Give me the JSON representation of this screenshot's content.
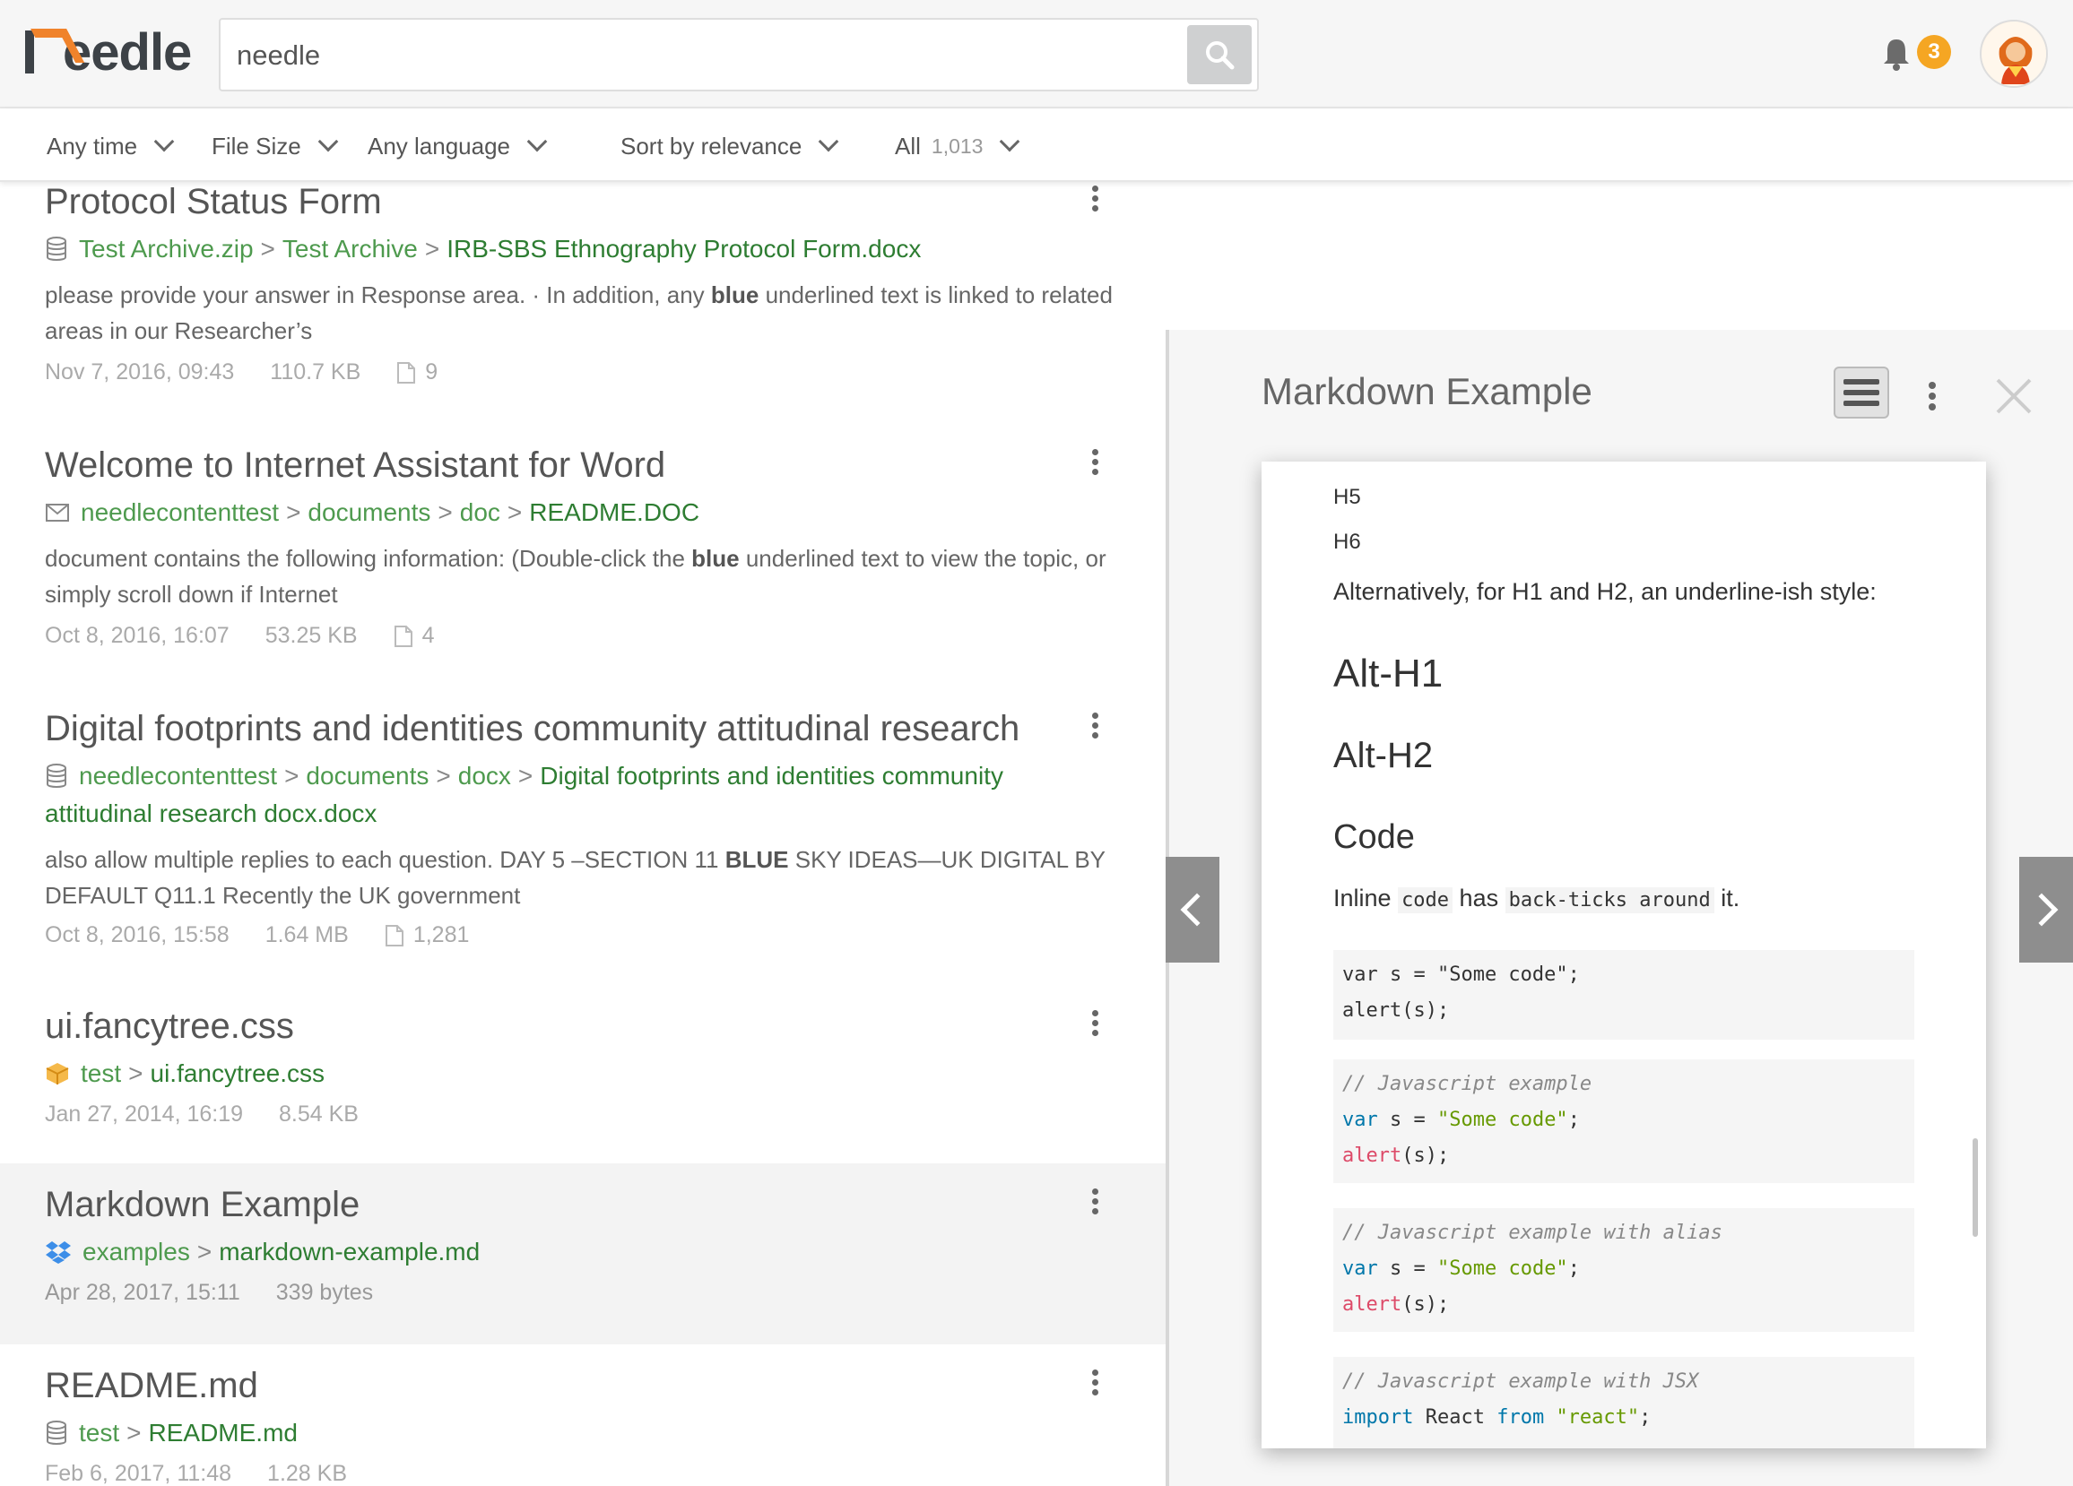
{
  "app": {
    "logo_text": "eedle",
    "brand_color": "#f0832b"
  },
  "search": {
    "query": "needle",
    "placeholder": ""
  },
  "notifications": {
    "count": "3"
  },
  "filters": {
    "time": "Any time",
    "file_size": "File Size",
    "language": "Any language",
    "sort": "Sort by relevance",
    "scope": "All",
    "scope_count": "1,013"
  },
  "results": [
    {
      "title": "Protocol Status Form",
      "source_icon": "database-icon",
      "path": [
        "Test Archive.zip",
        "Test Archive"
      ],
      "file": "IRB-SBS Ethnography Protocol Form.docx",
      "snippet_pre": "please provide your answer in Response area. · In addition, any ",
      "snippet_bold": "blue",
      "snippet_post": " underlined text is linked to related areas in our Researcher’s",
      "date": "Nov 7, 2016, 09:43",
      "size": "110.7 KB",
      "pages": "9"
    },
    {
      "title": "Welcome to Internet Assistant for Word",
      "source_icon": "mail-icon",
      "path": [
        "needlecontenttest",
        "documents",
        "doc"
      ],
      "file": "README.DOC",
      "snippet_pre": "document contains the following information: (Double-click the ",
      "snippet_bold": "blue",
      "snippet_post": " underlined text to view the topic, or simply scroll down if Internet",
      "date": "Oct 8, 2016, 16:07",
      "size": "53.25 KB",
      "pages": "4"
    },
    {
      "title": "Digital footprints and identities community attitudinal research",
      "source_icon": "database-icon",
      "path": [
        "needlecontenttest",
        "documents",
        "docx"
      ],
      "file": "Digital footprints and identities community attitudinal research docx.docx",
      "snippet_pre": "also allow multiple replies to each question. DAY 5 –SECTION 11 ",
      "snippet_bold": "BLUE",
      "snippet_post": " SKY IDEAS—UK DIGITAL BY DEFAULT Q11.1 Recently the UK government",
      "date": "Oct 8, 2016, 15:58",
      "size": "1.64 MB",
      "pages": "1,281"
    },
    {
      "title": "ui.fancytree.css",
      "source_icon": "box-icon",
      "path": [
        "test"
      ],
      "file": "ui.fancytree.css",
      "date": "Jan 27, 2014, 16:19",
      "size": "8.54 KB"
    },
    {
      "title": "Markdown Example",
      "source_icon": "dropbox-icon",
      "path": [
        "examples"
      ],
      "file": "markdown-example.md",
      "date": "Apr 28, 2017, 15:11",
      "size": "339 bytes"
    },
    {
      "title": "README.md",
      "source_icon": "database-icon",
      "path": [
        "test"
      ],
      "file": "README.md",
      "date": "Feb 6, 2017, 11:48",
      "size": "1.28 KB"
    }
  ],
  "preview": {
    "title": "Markdown Example",
    "doc": {
      "h5": "H5",
      "h6": "H6",
      "alt_intro": "Alternatively, for H1 and H2, an underline-ish style:",
      "alt_h1": "Alt-H1",
      "alt_h2": "Alt-H2",
      "code_heading": "Code",
      "inline_pre": "Inline ",
      "inline_code1": "code",
      "inline_mid": " has ",
      "inline_code2": "back-ticks around",
      "inline_post": " it.",
      "block1": [
        "var s = \"Some code\";",
        "alert(s);"
      ],
      "block2_comment": "// Javascript example",
      "block3_comment": "// Javascript example with alias",
      "block4_comment": "// Javascript example with JSX",
      "code_var_kw": "var",
      "code_var_name": " s = ",
      "code_str": "\"Some code\"",
      "code_semicolon": ";",
      "code_alert_fn": "alert",
      "code_alert_args": "(s);",
      "code_import_kw": "import",
      "code_import_name": " React ",
      "code_from_kw": "from",
      "code_react_str": "\"react\"",
      "code_end": ";"
    }
  }
}
